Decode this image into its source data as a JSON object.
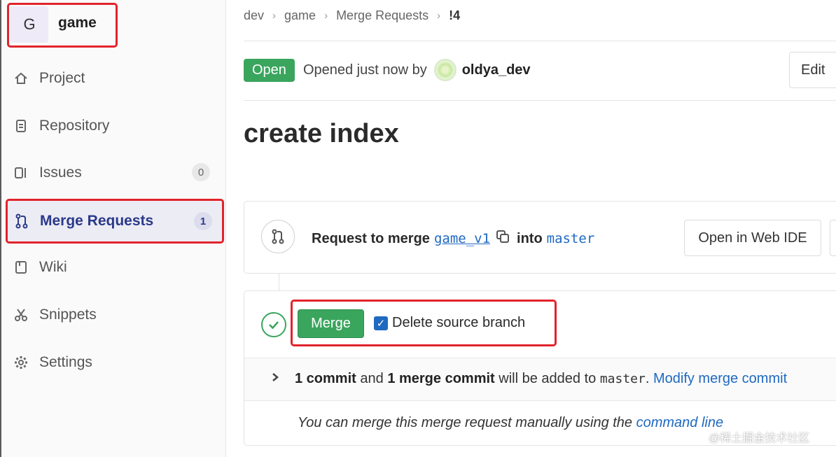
{
  "project": {
    "avatar_letter": "G",
    "name": "game"
  },
  "sidebar": {
    "items": [
      {
        "label": "Project",
        "icon": "home-icon"
      },
      {
        "label": "Repository",
        "icon": "doc-icon"
      },
      {
        "label": "Issues",
        "icon": "issues-icon",
        "badge": "0"
      },
      {
        "label": "Merge Requests",
        "icon": "merge-request-icon",
        "badge": "1",
        "active": true
      },
      {
        "label": "Wiki",
        "icon": "book-icon"
      },
      {
        "label": "Snippets",
        "icon": "scissors-icon"
      },
      {
        "label": "Settings",
        "icon": "gear-icon"
      }
    ]
  },
  "breadcrumbs": [
    "dev",
    "game",
    "Merge Requests",
    "!4"
  ],
  "mr": {
    "status": "Open",
    "opened_text": "Opened just now by",
    "author": "oldya_dev",
    "edit_label": "Edit",
    "title": "create index",
    "request_prefix": "Request to merge",
    "source_branch": "game_v1",
    "into_label": "into",
    "target_branch": "master",
    "web_ide_label": "Open in Web IDE",
    "merge_label": "Merge",
    "delete_branch_label": "Delete source branch",
    "commit_count": "1 commit",
    "and_text": "and",
    "merge_commit_count": "1 merge commit",
    "will_be_added": "will be added to",
    "commit_target": "master",
    "modify_link": "Modify merge commit",
    "manual_prefix": "You can merge this merge request manually using the",
    "manual_link": "command line"
  },
  "watermark": "@稀土掘金技术社区",
  "colors": {
    "accent_green": "#3aa55d",
    "link_blue": "#1f69c0",
    "highlight_red": "#e2232b"
  }
}
